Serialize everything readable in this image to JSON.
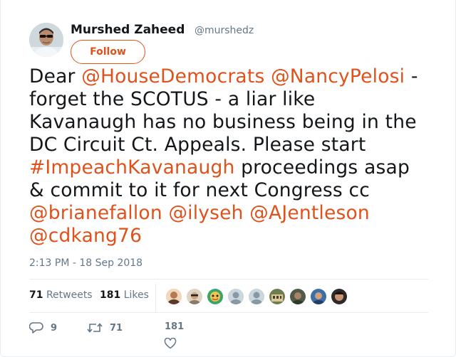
{
  "author": {
    "name": "Murshed Zaheed",
    "handle": "@murshedz",
    "follow_label": "Follow"
  },
  "tweet": {
    "lines": [
      [
        {
          "t": "Dear ",
          "link": false
        },
        {
          "t": "@HouseDemocrats",
          "link": true
        },
        {
          "t": " ",
          "link": false
        },
        {
          "t": "@NancyPelosi",
          "link": true
        },
        {
          "t": " -",
          "link": false
        }
      ],
      [
        {
          "t": "forget the SCOTUS - a liar like",
          "link": false
        }
      ],
      [
        {
          "t": "Kavanaugh has no business being in the",
          "link": false
        }
      ],
      [
        {
          "t": "DC Circuit Ct. Appeals. Please start",
          "link": false
        }
      ],
      [
        {
          "t": "#ImpeachKavanaugh",
          "link": true
        },
        {
          "t": " proceedings asap",
          "link": false
        }
      ],
      [
        {
          "t": "& commit to it for next Congress cc",
          "link": false
        }
      ],
      [
        {
          "t": "@brianefallon",
          "link": true
        },
        {
          "t": " ",
          "link": false
        },
        {
          "t": "@ilyseh",
          "link": true
        },
        {
          "t": " ",
          "link": false
        },
        {
          "t": "@AJentleson",
          "link": true
        }
      ],
      [
        {
          "t": "@cdkang76",
          "link": true
        }
      ]
    ],
    "timestamp": "2:13 PM - 18 Sep 2018"
  },
  "stats": {
    "retweets_count": "71",
    "retweets_label": "Retweets",
    "likes_count": "181",
    "likes_label": "Likes"
  },
  "actions": {
    "reply_count": "9",
    "retweet_count": "71",
    "like_count": "181"
  },
  "colors": {
    "link": "#e0521b",
    "text": "#14171a",
    "muted": "#657786",
    "border": "#e6ecf0"
  },
  "icons": {
    "reply": "reply-icon",
    "retweet": "retweet-icon",
    "like": "heart-icon"
  }
}
